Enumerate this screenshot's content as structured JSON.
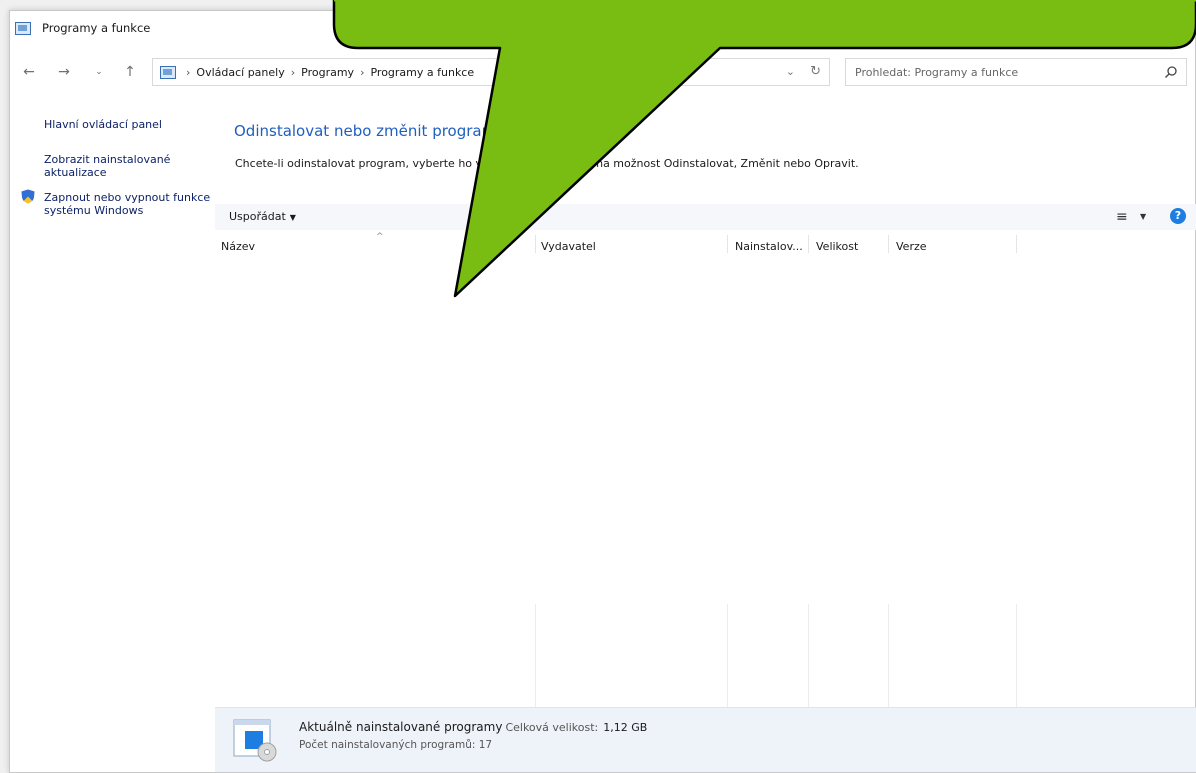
{
  "window": {
    "title": "Programy a funkce",
    "app_icon": "control-panel-icon"
  },
  "address_bar": {
    "breadcrumbs": [
      "Ovládací panely",
      "Programy",
      "Programy a funkce"
    ],
    "back_icon": "arrow-left-icon",
    "forward_icon": "arrow-right-icon",
    "recent_icon": "chevron-down-icon",
    "up_icon": "arrow-up-icon",
    "refresh_icon": "refresh-icon"
  },
  "search": {
    "placeholder": "Prohledat: Programy a funkce",
    "icon": "search-icon"
  },
  "left_pane": {
    "links": [
      {
        "label": "Hlavní ovládací panel"
      },
      {
        "label": "Zobrazit nainstalované aktualizace"
      },
      {
        "label": "Zapnout nebo vypnout funkce systému Windows",
        "icon": "shield-icon"
      }
    ]
  },
  "main": {
    "title": "Odinstalovat nebo změnit program",
    "description": "Chcete-li odinstalovat program, vyberte ho v seznamu a klikněte na možnost Odinstalovat, Změnit nebo Opravit."
  },
  "toolbar": {
    "organize_label": "Uspořádat",
    "view_icon": "list-view-icon",
    "help_icon": "help-icon",
    "help_label": "?"
  },
  "list": {
    "columns": [
      "Název",
      "Vydavatel",
      "Nainstalov...",
      "Velikost",
      "Verze"
    ],
    "rows": []
  },
  "status": {
    "title": "Aktuálně nainstalované programy",
    "total_size_label": "Celková velikost:",
    "total_size_value": "1,12 GB",
    "count_text": "Počet nainstalovaných programů: 17"
  },
  "colors": {
    "link": "#0a1f66",
    "heading": "#1f5fbf",
    "callout_fill": "#7abd12",
    "help_badge": "#1e7de0",
    "status_bg": "#eef3fa"
  }
}
